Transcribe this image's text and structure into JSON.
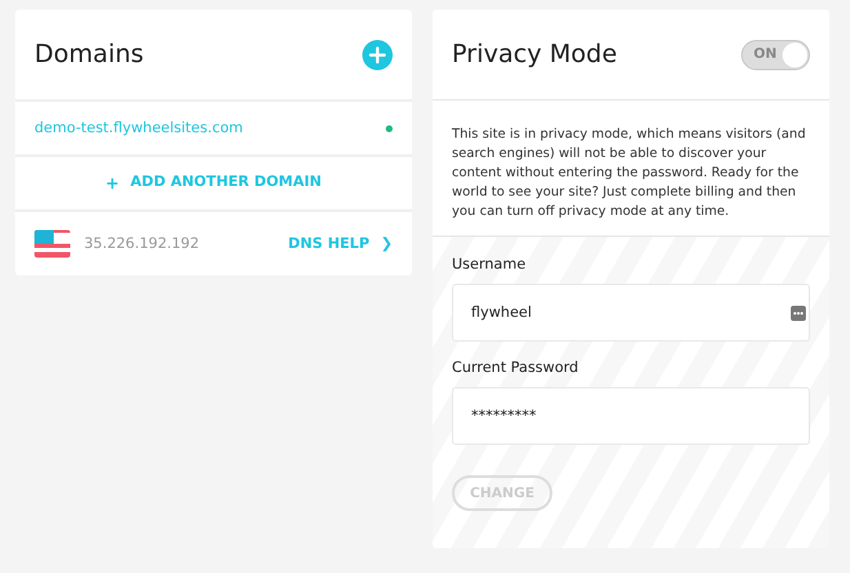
{
  "domains_panel": {
    "title": "Domains",
    "domains": [
      {
        "name": "demo-test.flywheelsites.com",
        "active": true
      }
    ],
    "add_label": "ADD ANOTHER DOMAIN",
    "add_icon": "+",
    "ip_address": "35.226.192.192",
    "dns_help": "DNS HELP",
    "dns_chevron": "❯"
  },
  "privacy_panel": {
    "title": "Privacy Mode",
    "toggle": {
      "label": "ON",
      "on": true
    },
    "description": "This site is in privacy mode, which means visitors (and search engines) will not be able to discover your content without entering the password. Ready for the world to see your site? Just complete billing and then you can turn off privacy mode at any time.",
    "fields": [
      {
        "label": "Username",
        "value": "flywheel",
        "kind": "text"
      },
      {
        "label": "Current Password",
        "value": "*********",
        "kind": "password"
      }
    ],
    "button": {
      "label": "CHANGE",
      "disabled": true
    }
  }
}
